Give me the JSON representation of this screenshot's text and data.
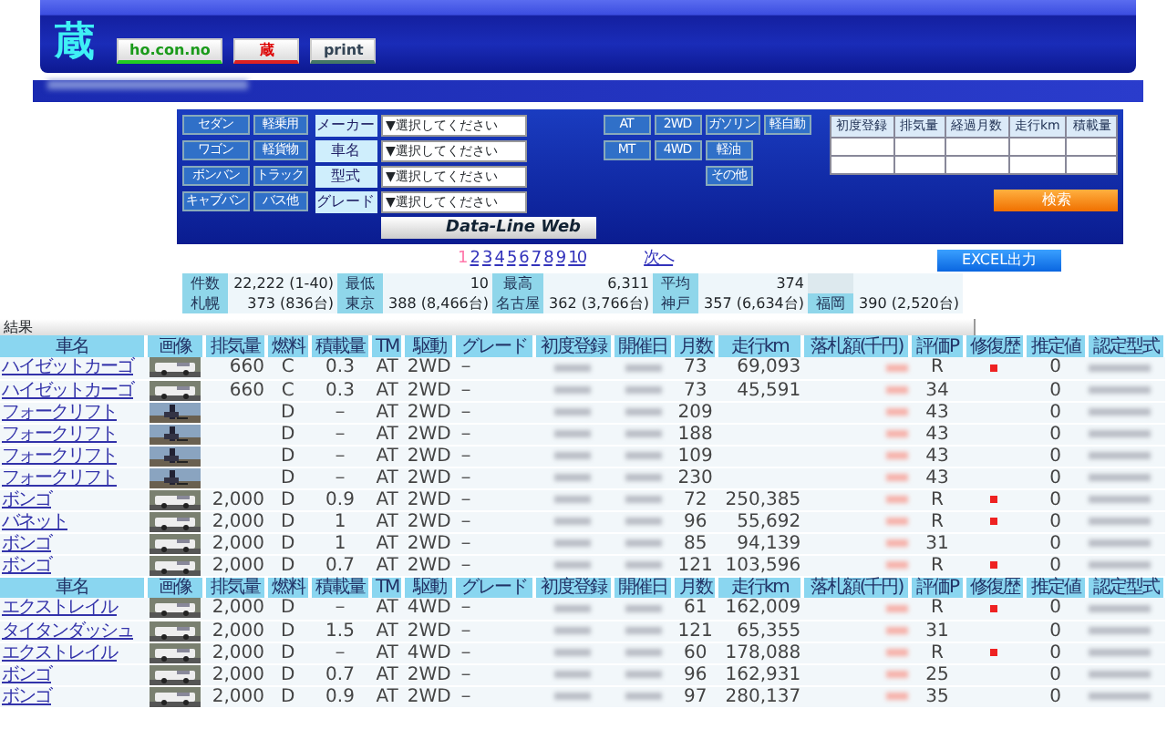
{
  "header": {
    "logo": "蔵",
    "buttons": [
      {
        "label": "ho.con.no",
        "kind": "green"
      },
      {
        "label": "蔵",
        "kind": "red"
      },
      {
        "label": "print",
        "kind": "grey"
      }
    ]
  },
  "search": {
    "body_types": [
      "セダン",
      "軽乗用",
      "ワゴン",
      "軽貨物",
      "ボンバン",
      "トラック",
      "キャブバン",
      "バス他"
    ],
    "selects": [
      {
        "label": "メーカー",
        "placeholder": "▼選択してください"
      },
      {
        "label": "車名",
        "placeholder": "▼選択してください"
      },
      {
        "label": "型式",
        "placeholder": "▼選択してください"
      },
      {
        "label": "グレード",
        "placeholder": "▼選択してください"
      }
    ],
    "toggles": [
      [
        "AT",
        "2WD",
        "ガソリン",
        "軽自動"
      ],
      [
        "MT",
        "4WD",
        "軽油"
      ],
      [
        "その他"
      ]
    ],
    "banner": "Data-Line Web",
    "ranges": [
      "初度登録",
      "排気量",
      "経過月数",
      "走行km",
      "積載量"
    ],
    "search_button": "検索"
  },
  "pagination": {
    "pages": [
      {
        "label": "1",
        "selected": true
      },
      {
        "label": "2",
        "selected": false
      },
      {
        "label": "3",
        "selected": false
      },
      {
        "label": "4",
        "selected": false
      },
      {
        "label": "5",
        "selected": false
      },
      {
        "label": "6",
        "selected": false
      },
      {
        "label": "7",
        "selected": false
      },
      {
        "label": "8",
        "selected": false
      },
      {
        "label": "9",
        "selected": false
      },
      {
        "label": "10",
        "selected": false
      }
    ],
    "next": "次へ"
  },
  "excel_button": "EXCEL出力",
  "stats": [
    [
      {
        "label": "件数",
        "value": "22,222 (1-40)"
      },
      {
        "label": "最低",
        "value": "10"
      },
      {
        "label": "最高",
        "value": "6,311"
      },
      {
        "label": "平均",
        "value": "374"
      }
    ],
    [
      {
        "label": "札幌",
        "value": "373 (836台)"
      },
      {
        "label": "東京",
        "value": "388 (8,466台)"
      },
      {
        "label": "名古屋",
        "value": "362 (3,766台)"
      },
      {
        "label": "神戸",
        "value": "357 (6,634台)"
      },
      {
        "label": "福岡",
        "value": "390 (2,520台)"
      }
    ]
  ],
  "results_title": "結果",
  "table": {
    "sections": [
      {
        "columns": [
          "車名",
          "画像",
          "排気量",
          "燃料",
          "積載量",
          "TM",
          "駆動",
          "グレード",
          "初度登録",
          "開催日",
          "月数",
          "走行km",
          "落札額(千円)",
          "評価P",
          "修復歴",
          "推定値",
          "認定型式"
        ],
        "rows": [
          {
            "name": "ハイゼットカーゴ",
            "displacement": "660",
            "fuel": "C",
            "load": "0.3",
            "tm": "AT",
            "drive": "2WD",
            "grade": "－",
            "months": "73",
            "km": "69,093",
            "score": "R",
            "repaired": true,
            "estimate": "0"
          },
          {
            "name": "ハイゼットカーゴ",
            "displacement": "660",
            "fuel": "C",
            "load": "0.3",
            "tm": "AT",
            "drive": "2WD",
            "grade": "－",
            "months": "73",
            "km": "45,591",
            "score": "34",
            "repaired": false,
            "estimate": "0"
          },
          {
            "name": "フォークリフト",
            "fuel": "D",
            "load": "－",
            "tm": "AT",
            "drive": "2WD",
            "grade": "－",
            "months": "209",
            "score": "43",
            "repaired": false,
            "estimate": "0"
          },
          {
            "name": "フォークリフト",
            "fuel": "D",
            "load": "－",
            "tm": "AT",
            "drive": "2WD",
            "grade": "－",
            "months": "188",
            "score": "43",
            "repaired": false,
            "estimate": "0"
          },
          {
            "name": "フォークリフト",
            "fuel": "D",
            "load": "－",
            "tm": "AT",
            "drive": "2WD",
            "grade": "－",
            "months": "109",
            "score": "43",
            "repaired": false,
            "estimate": "0"
          },
          {
            "name": "フォークリフト",
            "fuel": "D",
            "load": "－",
            "tm": "AT",
            "drive": "2WD",
            "grade": "－",
            "months": "230",
            "score": "43",
            "repaired": false,
            "estimate": "0"
          },
          {
            "name": "ボンゴ",
            "displacement": "2,000",
            "fuel": "D",
            "load": "0.9",
            "tm": "AT",
            "drive": "2WD",
            "grade": "－",
            "months": "72",
            "km": "250,385",
            "score": "R",
            "repaired": true,
            "estimate": "0"
          },
          {
            "name": "バネット",
            "displacement": "2,000",
            "fuel": "D",
            "load": "1",
            "tm": "AT",
            "drive": "2WD",
            "grade": "－",
            "months": "96",
            "km": "55,692",
            "score": "R",
            "repaired": true,
            "estimate": "0"
          },
          {
            "name": "ボンゴ",
            "displacement": "2,000",
            "fuel": "D",
            "load": "1",
            "tm": "AT",
            "drive": "2WD",
            "grade": "－",
            "months": "85",
            "km": "94,139",
            "score": "31",
            "repaired": false,
            "estimate": "0"
          },
          {
            "name": "ボンゴ",
            "displacement": "2,000",
            "fuel": "D",
            "load": "0.7",
            "tm": "AT",
            "drive": "2WD",
            "grade": "－",
            "months": "121",
            "km": "103,596",
            "score": "R",
            "repaired": true,
            "estimate": "0"
          }
        ]
      },
      {
        "columns": [
          "車名",
          "画像",
          "排気量",
          "燃料",
          "積載量",
          "TM",
          "駆動",
          "グレード",
          "初度登録",
          "開催日",
          "月数",
          "走行km",
          "落札額(千円)",
          "評価P",
          "修復歴",
          "推定値",
          "認定型式"
        ],
        "rows": [
          {
            "name": "エクストレイル",
            "displacement": "2,000",
            "fuel": "D",
            "load": "－",
            "tm": "AT",
            "drive": "4WD",
            "grade": "－",
            "months": "61",
            "km": "162,009",
            "score": "R",
            "repaired": true,
            "estimate": "0"
          },
          {
            "name": "タイタンダッシュ",
            "displacement": "2,000",
            "fuel": "D",
            "load": "1.5",
            "tm": "AT",
            "drive": "2WD",
            "grade": "－",
            "months": "121",
            "km": "65,355",
            "score": "31",
            "repaired": false,
            "estimate": "0"
          },
          {
            "name": "エクストレイル",
            "displacement": "2,000",
            "fuel": "D",
            "load": "－",
            "tm": "AT",
            "drive": "4WD",
            "grade": "－",
            "months": "60",
            "km": "178,088",
            "score": "R",
            "repaired": true,
            "estimate": "0"
          },
          {
            "name": "ボンゴ",
            "displacement": "2,000",
            "fuel": "D",
            "load": "0.7",
            "tm": "AT",
            "drive": "2WD",
            "grade": "－",
            "months": "96",
            "km": "162,931",
            "score": "25",
            "repaired": false,
            "estimate": "0"
          },
          {
            "name": "ボンゴ",
            "displacement": "2,000",
            "fuel": "D",
            "load": "0.9",
            "tm": "AT",
            "drive": "2WD",
            "grade": "－",
            "months": "97",
            "km": "280,137",
            "score": "35",
            "repaired": false,
            "estimate": "0"
          }
        ]
      }
    ]
  }
}
